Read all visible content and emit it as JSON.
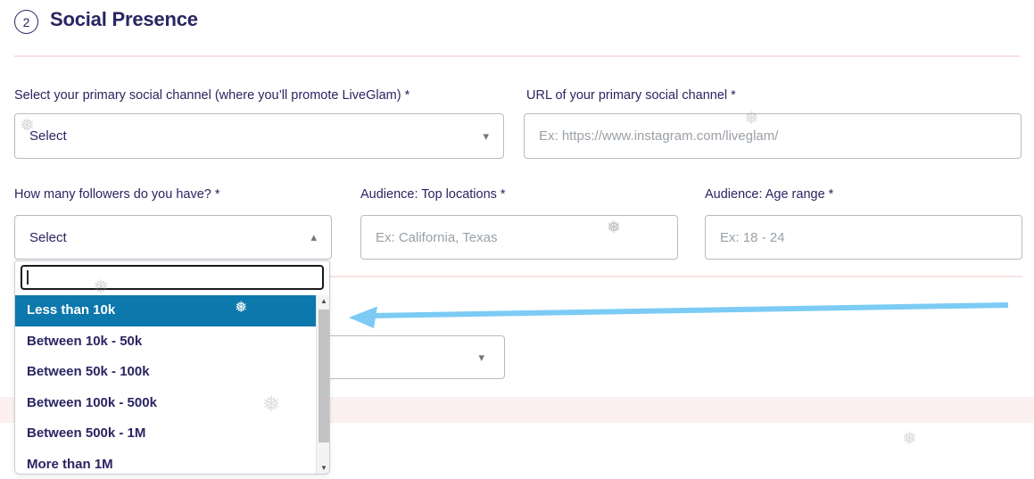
{
  "header": {
    "step_number": "2",
    "title": "Social Presence"
  },
  "fields": {
    "primary_channel": {
      "label": "Select your primary social channel (where you’ll promote LiveGlam) *",
      "value": "Select"
    },
    "url": {
      "label": "URL of your primary social channel *",
      "placeholder": "Ex: https://www.instagram.com/liveglam/"
    },
    "followers": {
      "label": "How many followers do you have? *",
      "value": "Select"
    },
    "top_locations": {
      "label": "Audience: Top locations *",
      "placeholder": "Ex: California, Texas"
    },
    "age_range": {
      "label": "Audience: Age range *",
      "placeholder": "Ex: 18 - 24"
    }
  },
  "dropdown": {
    "search_value": "",
    "options": [
      {
        "label": "Less than 10k",
        "highlighted": true
      },
      {
        "label": "Between 10k - 50k",
        "highlighted": false
      },
      {
        "label": "Between 50k - 100k",
        "highlighted": false
      },
      {
        "label": "Between 100k - 500k",
        "highlighted": false
      },
      {
        "label": "Between 500k - 1M",
        "highlighted": false
      },
      {
        "label": "More than 1M",
        "highlighted": false
      }
    ]
  },
  "icons": {
    "snowflake": "❅",
    "caret_down": "▾",
    "caret_up": "▴",
    "scroll_up": "▲",
    "scroll_down": "▼"
  },
  "colors": {
    "navy_text": "#2a2462",
    "highlight_blue": "#0d78ac",
    "arrow_blue": "#7ccbf4",
    "pink_divider": "#f9e2e2",
    "pink_band": "#fcf0f0",
    "field_border": "#b5bbc3",
    "placeholder_gray": "#99a0a7"
  }
}
